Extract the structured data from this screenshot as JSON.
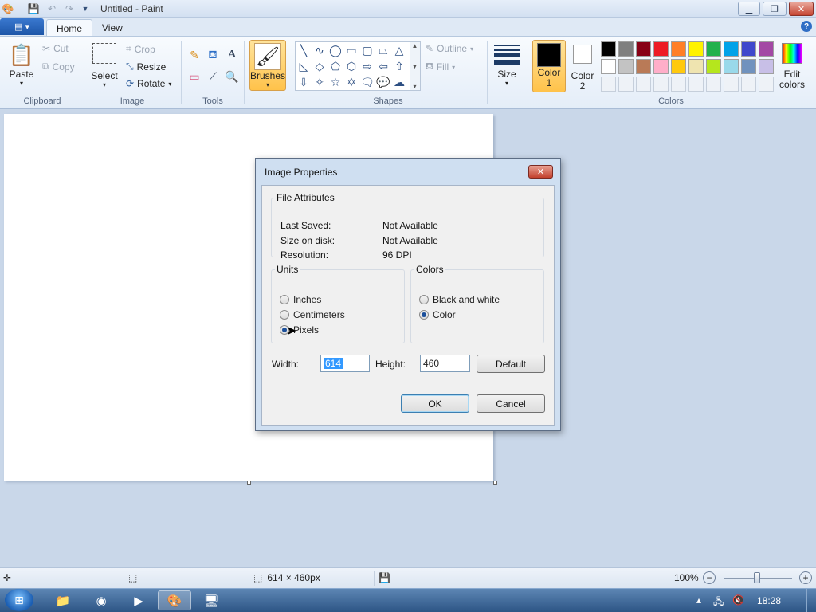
{
  "window": {
    "title": "Untitled - Paint"
  },
  "tabs": [
    {
      "label": "Home"
    },
    {
      "label": "View"
    }
  ],
  "ribbon": {
    "clipboard": {
      "label": "Clipboard",
      "paste": "Paste",
      "cut": "Cut",
      "copy": "Copy"
    },
    "image": {
      "label": "Image",
      "select": "Select",
      "crop": "Crop",
      "resize": "Resize",
      "rotate": "Rotate"
    },
    "tools": {
      "label": "Tools"
    },
    "brushes": {
      "label": "Brushes"
    },
    "shapes": {
      "label": "Shapes",
      "outline": "Outline",
      "fill": "Fill"
    },
    "size": {
      "label": "Size"
    },
    "colors": {
      "label": "Colors",
      "color1": "Color\n1",
      "color1_a": "Color",
      "color1_b": "1",
      "color2_a": "Color",
      "color2_b": "2",
      "edit_a": "Edit",
      "edit_b": "colors",
      "palette_row1": [
        "#000000",
        "#7f7f7f",
        "#880015",
        "#ed1c24",
        "#ff7f27",
        "#fff200",
        "#22b14c",
        "#00a2e8",
        "#3f48cc",
        "#a349a4"
      ],
      "palette_row2": [
        "#ffffff",
        "#c3c3c3",
        "#b97a57",
        "#ffaec9",
        "#ffc90e",
        "#efe4b0",
        "#b5e61d",
        "#99d9ea",
        "#7092be",
        "#c8bfe7"
      ]
    }
  },
  "dialog": {
    "title": "Image Properties",
    "file_attributes": {
      "legend": "File Attributes",
      "rows": [
        {
          "label": "Last Saved:",
          "value": "Not Available"
        },
        {
          "label": "Size on disk:",
          "value": "Not Available"
        },
        {
          "label": "Resolution:",
          "value": "96 DPI"
        }
      ]
    },
    "units": {
      "legend": "Units",
      "options": [
        {
          "label": "Inches",
          "selected": false
        },
        {
          "label": "Centimeters",
          "selected": false
        },
        {
          "label": "Pixels",
          "selected": true
        }
      ]
    },
    "colors": {
      "legend": "Colors",
      "options": [
        {
          "label": "Black and white",
          "selected": false
        },
        {
          "label": "Color",
          "selected": true
        }
      ]
    },
    "width_label": "Width:",
    "width_value": "614",
    "height_label": "Height:",
    "height_value": "460",
    "default_button": "Default",
    "ok_button": "OK",
    "cancel_button": "Cancel"
  },
  "statusbar": {
    "dimensions": "614 × 460px",
    "zoom": "100%"
  },
  "taskbar": {
    "clock": "18:28"
  }
}
